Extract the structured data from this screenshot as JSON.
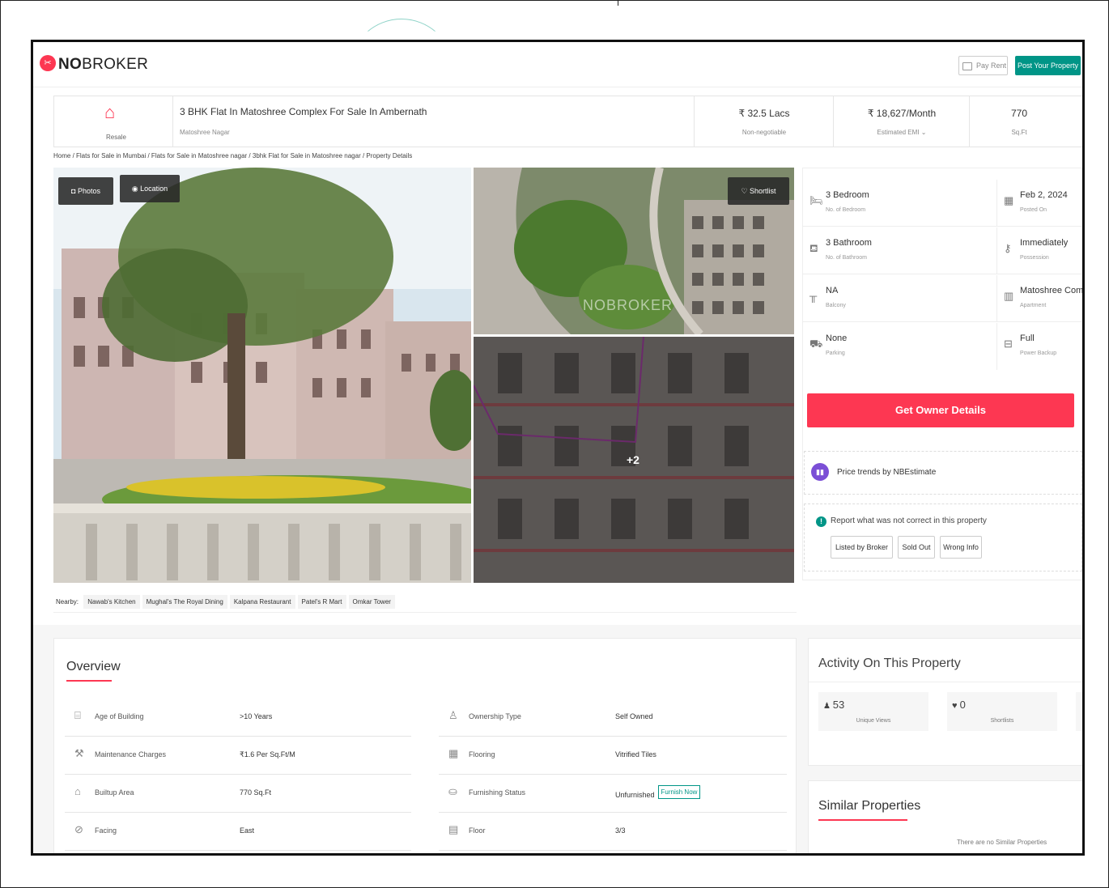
{
  "header": {
    "logo_bold": "NO",
    "logo_rest": "BROKER",
    "pay_rent": "Pay Rent",
    "post_property": "Post Your Property"
  },
  "listing": {
    "type_label": "Resale",
    "title": "3 BHK Flat In Matoshree Complex For Sale In Ambernath",
    "locality": "Matoshree Nagar",
    "price": "₹ 32.5 Lacs",
    "price_sub": "Non-negotiable",
    "emi": "₹ 18,627/Month",
    "emi_sub": "Estimated EMI ⌄",
    "area": "770",
    "area_sub": "Sq.Ft"
  },
  "breadcrumb": "Home / Flats for Sale in Mumbai / Flats for Sale in Matoshree nagar / 3bhk Flat for Sale in Matoshree nagar / Property Details",
  "gallery": {
    "photos_btn": "Photos",
    "location_btn": "Location",
    "shortlist_btn": "Shortlist",
    "more_count": "+2",
    "watermark": "NOBROKER"
  },
  "nearby": {
    "label": "Nearby:",
    "items": [
      "Nawab's Kitchen",
      "Mughal's The Royal Dining",
      "Kalpana Restaurant",
      "Patel's R Mart",
      "Omkar Tower"
    ]
  },
  "details": [
    {
      "value": "3 Bedroom",
      "label": "No. of Bedroom",
      "icon": "bed-icon"
    },
    {
      "value": "Feb 2, 2024",
      "label": "Posted On",
      "icon": "calendar-icon"
    },
    {
      "value": "3 Bathroom",
      "label": "No. of Bathroom",
      "icon": "bathtub-icon"
    },
    {
      "value": "Immediately",
      "label": "Possession",
      "icon": "key-icon"
    },
    {
      "value": "NA",
      "label": "Balcony",
      "icon": "balcony-icon"
    },
    {
      "value": "Matoshree Complex",
      "label": "Apartment",
      "icon": "building-icon"
    },
    {
      "value": "None",
      "label": "Parking",
      "icon": "car-icon"
    },
    {
      "value": "Full",
      "label": "Power Backup",
      "icon": "battery-icon"
    }
  ],
  "cta": {
    "owner_details": "Get Owner Details",
    "price_trends": "Price trends by NBEstimate",
    "report_text": "Report what was not correct in this property",
    "report_buttons": [
      "Listed by Broker",
      "Sold Out",
      "Wrong Info"
    ]
  },
  "overview": {
    "title": "Overview",
    "rows": [
      {
        "label": "Age of Building",
        "value": ">10 Years",
        "icon": "building-age-icon"
      },
      {
        "label": "Ownership Type",
        "value": "Self Owned",
        "icon": "ownership-icon"
      },
      {
        "label": "Maintenance Charges",
        "value": "₹1.6 Per Sq.Ft/M",
        "icon": "tools-icon"
      },
      {
        "label": "Flooring",
        "value": "Vitrified Tiles",
        "icon": "flooring-icon"
      },
      {
        "label": "Builtup Area",
        "value": "770 Sq.Ft",
        "icon": "area-icon"
      },
      {
        "label": "Furnishing Status",
        "value": "Unfurnished",
        "icon": "furnishing-icon"
      },
      {
        "label": "Facing",
        "value": "East",
        "icon": "compass-icon"
      },
      {
        "label": "Floor",
        "value": "3/3",
        "icon": "floor-icon"
      }
    ],
    "furnish_now": "Furnish Now"
  },
  "activity": {
    "title": "Activity On This Property",
    "views": "53",
    "views_label": "Unique Views",
    "shortlists": "0",
    "shortlists_label": "Shortlists"
  },
  "similar": {
    "title": "Similar Properties",
    "empty": "There are no Similar Properties"
  },
  "colors": {
    "brand": "#fd3752",
    "accent": "#009587",
    "trends": "#7b4fd6"
  }
}
